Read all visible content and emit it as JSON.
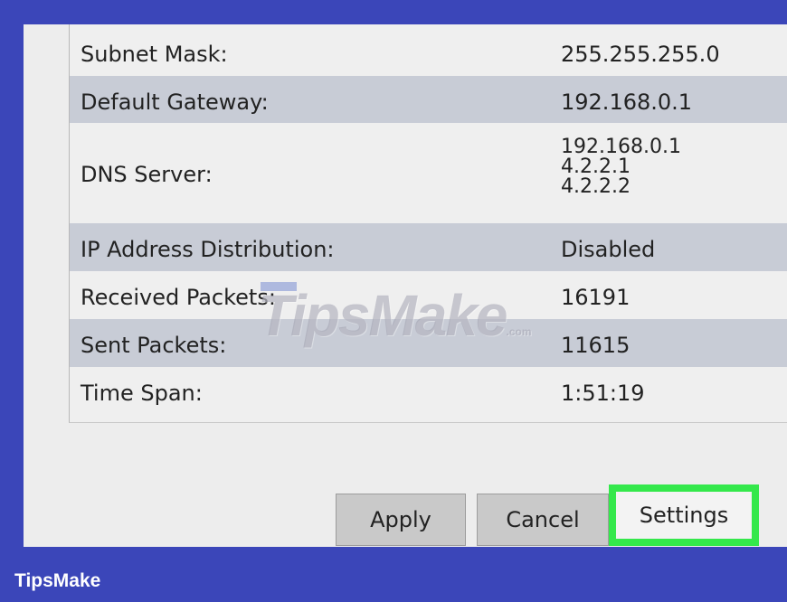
{
  "rows": [
    {
      "label": "Subnet Mask:",
      "value": "255.255.255.0"
    },
    {
      "label": "Default Gateway:",
      "value": "192.168.0.1"
    },
    {
      "label": "DNS Server:",
      "values": [
        "192.168.0.1",
        "4.2.2.1",
        "4.2.2.2"
      ]
    },
    {
      "label": "IP Address Distribution:",
      "value": "Disabled"
    },
    {
      "label": "Received Packets:",
      "value": "16191"
    },
    {
      "label": "Sent Packets:",
      "value": "11615"
    },
    {
      "label": "Time Span:",
      "value": "1:51:19"
    }
  ],
  "buttons": {
    "apply": "Apply",
    "cancel": "Cancel",
    "settings": "Settings"
  },
  "watermark": {
    "text": "TipsMake",
    "suffix": ".com"
  },
  "brand": "TipsMake",
  "colors": {
    "background": "#3b46b9",
    "highlight": "#34e84b",
    "row_alt": "#c8ccd6"
  }
}
